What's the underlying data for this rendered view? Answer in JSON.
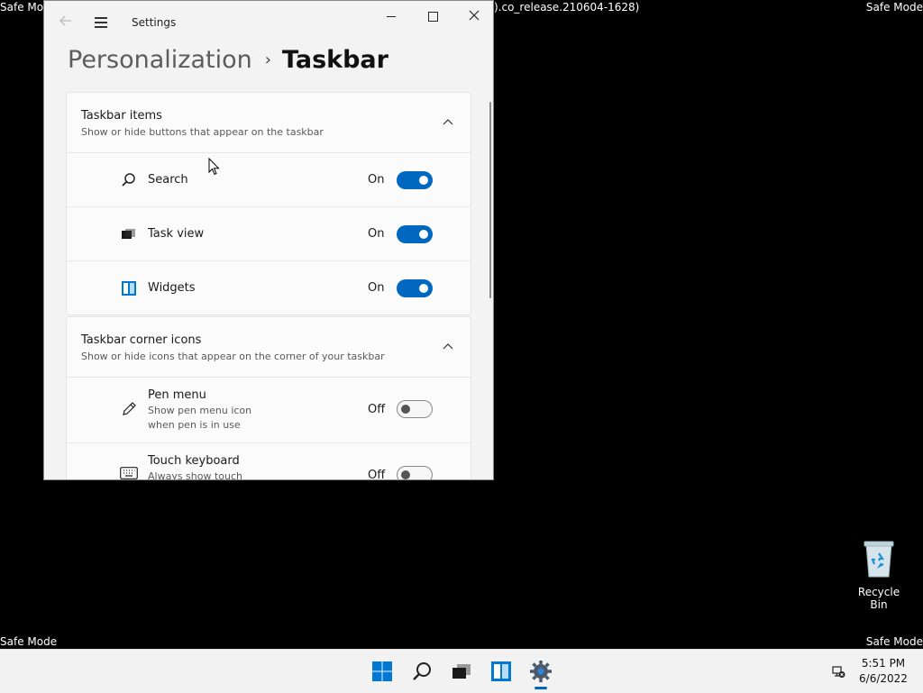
{
  "desktop": {
    "safe_mode_label": "Safe Mode",
    "build_text": ").co_release.210604-1628)",
    "recycle_bin_label": "Recycle Bin"
  },
  "window": {
    "title": "Settings",
    "breadcrumb_parent": "Personalization",
    "breadcrumb_separator": "›",
    "breadcrumb_current": "Taskbar"
  },
  "sections": {
    "taskbar_items": {
      "title": "Taskbar items",
      "subtitle": "Show or hide buttons that appear on the taskbar",
      "items": [
        {
          "label": "Search",
          "state": "On",
          "icon": "search-icon"
        },
        {
          "label": "Task view",
          "state": "On",
          "icon": "task-view-icon"
        },
        {
          "label": "Widgets",
          "state": "On",
          "icon": "widgets-icon"
        }
      ]
    },
    "corner_icons": {
      "title": "Taskbar corner icons",
      "subtitle": "Show or hide icons that appear on the corner of your taskbar",
      "items": [
        {
          "label": "Pen menu",
          "sub1": "Show pen menu icon",
          "sub2": "when pen is in use",
          "state": "Off",
          "icon": "pen-icon"
        },
        {
          "label": "Touch keyboard",
          "sub1": "Always show touch",
          "state": "Off",
          "icon": "keyboard-icon"
        }
      ]
    }
  },
  "taskbar": {
    "time": "5:51 PM",
    "date": "6/6/2022"
  },
  "colors": {
    "accent": "#0067c0"
  }
}
